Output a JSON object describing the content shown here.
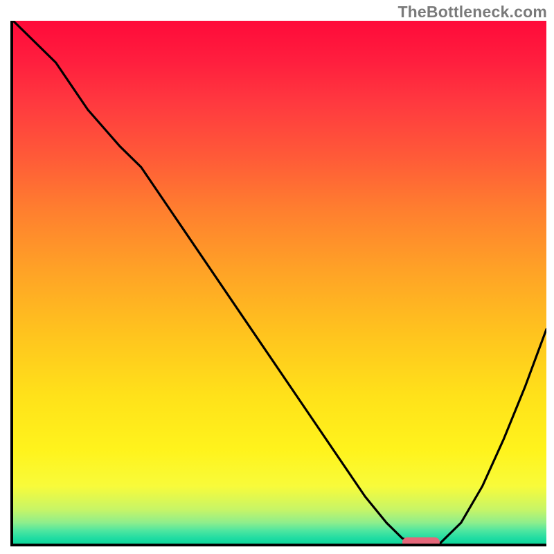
{
  "watermark": "TheBottleneck.com",
  "colors": {
    "axis": "#000000",
    "curve": "#000000",
    "marker": "#e4677a",
    "gradient_top": "#ff0a3a",
    "gradient_bottom": "#0fd69a"
  },
  "chart_data": {
    "type": "line",
    "title": "",
    "xlabel": "",
    "ylabel": "",
    "xlim": [
      0,
      100
    ],
    "ylim": [
      0,
      100
    ],
    "grid": false,
    "legend": false,
    "annotations": [],
    "x": [
      0,
      8,
      14,
      20,
      24,
      30,
      36,
      42,
      48,
      54,
      60,
      66,
      70,
      73,
      76,
      80,
      84,
      88,
      92,
      96,
      100
    ],
    "values": [
      100,
      92,
      83,
      76,
      72,
      63,
      54,
      45,
      36,
      27,
      18,
      9,
      4,
      1,
      0,
      0,
      4,
      11,
      20,
      30,
      41
    ],
    "marker": {
      "x_start": 73,
      "x_end": 80,
      "y": 0
    }
  }
}
